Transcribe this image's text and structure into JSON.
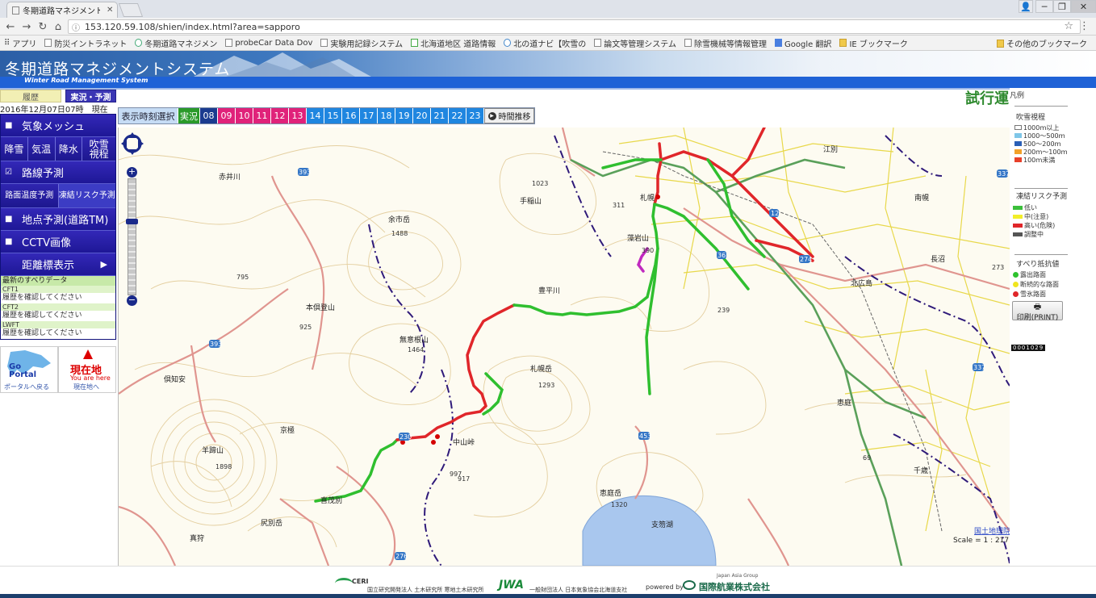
{
  "browser": {
    "tab_title": "冬期道路マネジメントシ",
    "url": "153.120.59.108/shien/index.html?area=sapporo",
    "bookmarks": [
      "アプリ",
      "防災イントラネット",
      "冬期道路マネジメン",
      "probeCar Data Dov",
      "実験用記録システム",
      "北海道地区 道路情報",
      "北の道ナビ【吹雪の",
      "論文等管理システム",
      "除雪機械等情報管理",
      "Google 翻訳",
      "IE ブックマーク"
    ],
    "other_bookmarks": "その他のブックマーク"
  },
  "app": {
    "title": "冬期道路マネジメントシステム",
    "subtitle": "Winter Road Management System",
    "trial_label": "試行運"
  },
  "left_panel": {
    "tab_history": "履歴",
    "tab_forecast": "実況・予測",
    "datetime": "2016年12月07日07時　現在",
    "weather_mesh": "気象メッシュ",
    "mesh_buttons": [
      "降雪",
      "気温",
      "降水",
      "吹雪視程"
    ],
    "route_forecast": "路線予測",
    "route_buttons": [
      "路面温度予測",
      "凍結リスク予測"
    ],
    "point_forecast": "地点予測(道路TM)",
    "cctv": "CCTV画像",
    "distance_marker": "距離標表示",
    "latest_slip": "最新のすべりデータ",
    "cft1": "CFT1",
    "cft1_msg": "履歴を確認してください",
    "cft2": "CFT2",
    "cft2_msg": "履歴を確認してください",
    "lwft": "LWFT",
    "lwft_msg": "履歴を確認してください",
    "goportal": "Go Portal",
    "goportal_sub": "ポータルへ戻る",
    "genzai": "現在地",
    "genzai_en": "You are here",
    "genzai_sub": "現在地へ"
  },
  "timebar": {
    "select_label": "表示時刻選択",
    "live_label": "実況",
    "hours": [
      "08",
      "09",
      "10",
      "11",
      "12",
      "13",
      "14",
      "15",
      "16",
      "17",
      "18",
      "19",
      "20",
      "21",
      "22",
      "23"
    ],
    "transition_label": "時間推移"
  },
  "map": {
    "places": [
      "赤井川",
      "余市岳",
      "手稲山",
      "札幌",
      "藻岩山",
      "本倶登山",
      "無意根山",
      "札幌岳",
      "喜茂別",
      "中山峠",
      "羊蹄山",
      "京極",
      "倶知安",
      "尻別岳",
      "恵庭岳",
      "恵庭",
      "北広島",
      "長沼",
      "南幌",
      "江別",
      "真狩",
      "千歳",
      "豊平川",
      "支笏湖"
    ],
    "elevations": [
      "1488",
      "1023",
      "311",
      "390",
      "795",
      "925",
      "1464",
      "1293",
      "239",
      "1898",
      "997",
      "917",
      "1320",
      "69",
      "273"
    ],
    "route_numbers": [
      "393",
      "12",
      "274",
      "36",
      "453",
      "230",
      "276",
      "337"
    ],
    "credit": "国土地理院",
    "scale": "Scale = 1 : 217K"
  },
  "legend": {
    "title": "凡例",
    "visibility_title": "吹雪視程",
    "visibility_items": [
      {
        "label": "1000ｍ以上",
        "color": "#ffffff"
      },
      {
        "label": "1000～500ｍ",
        "color": "#7fc6e8"
      },
      {
        "label": "500～200ｍ",
        "color": "#2a5fb6"
      },
      {
        "label": "200ｍ～100ｍ",
        "color": "#f2a12a"
      },
      {
        "label": "100ｍ未満",
        "color": "#e8402a"
      }
    ],
    "risk_title": "凍結リスク予測",
    "risk_items": [
      {
        "label": "低い",
        "color": "#3bbf3b"
      },
      {
        "label": "中(注意)",
        "color": "#f2ee2a"
      },
      {
        "label": "高い(危険)",
        "color": "#e0262a"
      },
      {
        "label": "調整中",
        "color": "#555555"
      }
    ],
    "slip_title": "すべり抵抗値",
    "slip_items": [
      {
        "label": "露出路面",
        "color": "#2ec22e"
      },
      {
        "label": "断続的な路面",
        "color": "#f0e520"
      },
      {
        "label": "雪氷路面",
        "color": "#e0262a"
      }
    ],
    "print_label": "印刷(PRINT)",
    "counter": "0001029"
  },
  "footer": {
    "ceri": "CERI",
    "ceri_text": "国立研究開発法人 土木研究所 寒地土木研究所",
    "jwa": "JWA",
    "jwa_text": "一般財団法人 日本気象協会北海道支社",
    "powered": "powered by",
    "kokusai": "国際航業株式会社",
    "asia": "Japan Asia Group"
  }
}
